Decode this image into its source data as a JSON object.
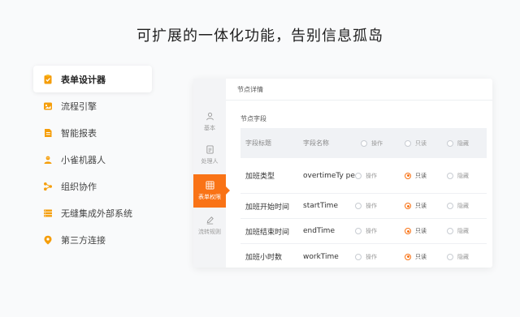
{
  "headline": "可扩展的一体化功能，告别信息孤岛",
  "features": [
    {
      "label": "表单设计器",
      "icon": "form-designer-icon",
      "active": true
    },
    {
      "label": "流程引擎",
      "icon": "process-engine-icon",
      "active": false
    },
    {
      "label": "智能报表",
      "icon": "report-icon",
      "active": false
    },
    {
      "label": "小雀机器人",
      "icon": "robot-icon",
      "active": false
    },
    {
      "label": "组织协作",
      "icon": "collaboration-icon",
      "active": false
    },
    {
      "label": "无缝集成外部系统",
      "icon": "integration-icon",
      "active": false
    },
    {
      "label": "第三方连接",
      "icon": "third-party-icon",
      "active": false
    }
  ],
  "panel": {
    "title": "节点详情",
    "section_title": "节点字段",
    "tabs": [
      {
        "label": "基本",
        "icon": "user-icon",
        "active": false
      },
      {
        "label": "处理人",
        "icon": "document-icon",
        "active": false
      },
      {
        "label": "表单权限",
        "icon": "grid-icon",
        "active": true
      },
      {
        "label": "流转规则",
        "icon": "pen-icon",
        "active": false
      }
    ],
    "table": {
      "headers": {
        "field_title": "字段标题",
        "field_name": "字段名称",
        "op": "操作",
        "readonly": "只读",
        "hidden": "隐藏"
      },
      "rows": [
        {
          "title": "加班类型",
          "name": "overtimeTy pe",
          "op": "操作",
          "readonly": "只读",
          "hidden": "隐藏",
          "selected": "readonly"
        },
        {
          "title": "加班开始时间",
          "name": "startTime",
          "op": "操作",
          "readonly": "只读",
          "hidden": "隐藏",
          "selected": "readonly"
        },
        {
          "title": "加班结束时间",
          "name": "endTime",
          "op": "操作",
          "readonly": "只读",
          "hidden": "隐藏",
          "selected": "readonly"
        },
        {
          "title": "加班小时数",
          "name": "workTime",
          "op": "操作",
          "readonly": "只读",
          "hidden": "隐藏",
          "selected": "readonly"
        }
      ]
    }
  },
  "colors": {
    "accent": "#f97316",
    "icon": "#f59e0b"
  }
}
